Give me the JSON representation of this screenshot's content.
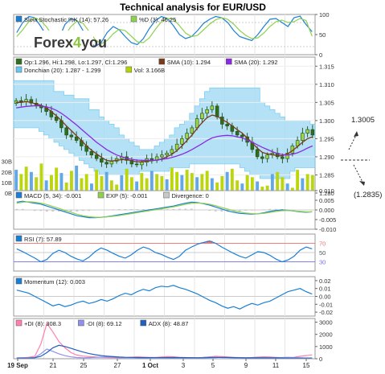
{
  "chart_data": {
    "type": "line",
    "title": "Technical analysis for EUR/USD",
    "brand": "Forex4you",
    "x_axis": {
      "ticks": [
        "19 Sep",
        "21",
        "25",
        "27",
        "1 Oct",
        "3",
        "5",
        "9",
        "11",
        "15"
      ]
    },
    "annotations": [
      {
        "text": "1.3005",
        "direction": "up"
      },
      {
        "text": "(1.2835)",
        "direction": "down"
      }
    ],
    "panels": [
      {
        "id": "stochastic",
        "legend": [
          {
            "label": "Slow Stochastic %K (14): 57.26",
            "color": "#1a7fd4"
          },
          {
            "label": "%D (3): 46.25",
            "color": "#8fd14f"
          }
        ],
        "y_ticks": [
          "100",
          "50",
          "0"
        ],
        "ylim": [
          0,
          100
        ],
        "series": [
          {
            "color": "#1a7fd4",
            "values": [
              55,
              80,
              95,
              92,
              70,
              45,
              25,
              40,
              75,
              90,
              85,
              60,
              35,
              20,
              30,
              55,
              70,
              62,
              45,
              30,
              25,
              40,
              65,
              85,
              95,
              90,
              72,
              50,
              40,
              45,
              60,
              78,
              88,
              95,
              92,
              80,
              60,
              45,
              40,
              35,
              50,
              70,
              88,
              90,
              80,
              70,
              92,
              96,
              75,
              57
            ]
          },
          {
            "color": "#8fd14f",
            "values": [
              45,
              62,
              82,
              92,
              85,
              68,
              45,
              35,
              48,
              70,
              84,
              78,
              58,
              38,
              27,
              35,
              52,
              63,
              60,
              46,
              32,
              30,
              42,
              63,
              82,
              90,
              88,
              72,
              54,
              45,
              48,
              62,
              76,
              87,
              92,
              88,
              76,
              60,
              48,
              40,
              42,
              54,
              70,
              82,
              86,
              80,
              82,
              90,
              85,
              46
            ]
          }
        ]
      },
      {
        "id": "price",
        "legend": [
          {
            "label": "Op:1.296, Hi:1.298, Lo:1.297, Cl:1.296",
            "color": "#2f6d1f"
          },
          {
            "label": "SMA (10): 1.294",
            "color": "#7a3b1a"
          },
          {
            "label": "SMA (20): 1.292",
            "color": "#8a2be2"
          },
          {
            "label": "Donchian (20): 1.287 - 1.299",
            "color": "#66c7f0"
          },
          {
            "label": "Vol: 3.166B",
            "color": "#b8d400"
          }
        ],
        "y_ticks": [
          "1.315",
          "1.310",
          "1.305",
          "1.300",
          "1.295",
          "1.290",
          "1.285",
          "1.280"
        ],
        "ylim": [
          1.28,
          1.3175
        ],
        "volume_ticks": [
          "30B",
          "20B",
          "10B",
          "0B"
        ],
        "volume_max": 32,
        "close": [
          1.3055,
          1.3052,
          1.3058,
          1.3048,
          1.304,
          1.3035,
          1.3025,
          1.301,
          1.3,
          1.298,
          1.296,
          1.2955,
          1.2945,
          1.293,
          1.2915,
          1.2905,
          1.2895,
          1.2885,
          1.288,
          1.2888,
          1.2895,
          1.29,
          1.289,
          1.288,
          1.2878,
          1.2885,
          1.2895,
          1.289,
          1.29,
          1.2905,
          1.291,
          1.292,
          1.2935,
          1.295,
          1.2965,
          1.298,
          1.3005,
          1.302,
          1.303,
          1.304,
          1.301,
          1.299,
          1.2985,
          1.297,
          1.296,
          1.2955,
          1.294,
          1.292,
          1.29,
          1.2895,
          1.2905,
          1.291,
          1.29,
          1.2895,
          1.291,
          1.293,
          1.2945,
          1.2965,
          1.2975,
          1.296
        ],
        "volume": [
          22,
          18,
          25,
          20,
          15,
          28,
          12,
          17,
          24,
          19,
          10,
          21,
          26,
          14,
          18,
          9,
          22,
          16,
          20,
          12,
          8,
          17,
          23,
          15,
          11,
          19,
          14,
          21,
          18,
          16,
          13,
          24,
          20,
          17,
          22,
          19,
          15,
          18,
          21,
          14,
          10,
          16,
          20,
          23,
          12,
          9,
          17,
          15,
          11,
          6,
          7,
          18,
          20,
          15,
          9,
          5,
          22,
          14,
          18,
          17
        ],
        "sma10": [
          1.305,
          1.305,
          1.3052,
          1.305,
          1.3045,
          1.3042,
          1.3035,
          1.3025,
          1.3013,
          1.3,
          1.2985,
          1.2972,
          1.2958,
          1.2945,
          1.293,
          1.2918,
          1.2908,
          1.2898,
          1.289,
          1.2888,
          1.289,
          1.2892,
          1.2892,
          1.2889,
          1.2886,
          1.2886,
          1.2888,
          1.2889,
          1.2891,
          1.2894,
          1.29,
          1.2907,
          1.2917,
          1.293,
          1.2945,
          1.296,
          1.2978,
          1.2994,
          1.3008,
          1.3015,
          1.3012,
          1.3003,
          1.2995,
          1.2985,
          1.2975,
          1.2965,
          1.2952,
          1.2938,
          1.2924,
          1.2912,
          1.2908,
          1.2906,
          1.2903,
          1.2903,
          1.2908,
          1.2917,
          1.2928,
          1.294,
          1.295,
          1.2955
        ],
        "sma20": [
          1.3035,
          1.3037,
          1.3039,
          1.304,
          1.3041,
          1.304,
          1.3038,
          1.3034,
          1.3028,
          1.302,
          1.301,
          1.2999,
          1.2988,
          1.2976,
          1.2964,
          1.2952,
          1.294,
          1.293,
          1.292,
          1.2912,
          1.2905,
          1.29,
          1.2896,
          1.2893,
          1.2891,
          1.289,
          1.289,
          1.289,
          1.2891,
          1.2893,
          1.2895,
          1.2898,
          1.2902,
          1.2907,
          1.2913,
          1.292,
          1.2928,
          1.2936,
          1.2945,
          1.2952,
          1.2956,
          1.2958,
          1.2959,
          1.2958,
          1.2955,
          1.2952,
          1.2946,
          1.294,
          1.2933,
          1.2926,
          1.292,
          1.2914,
          1.2909,
          1.2906,
          1.2905,
          1.2907,
          1.2911,
          1.2917,
          1.2924,
          1.293
        ],
        "donchian_upper": [
          1.311,
          1.311,
          1.311,
          1.311,
          1.311,
          1.311,
          1.311,
          1.311,
          1.308,
          1.308,
          1.307,
          1.307,
          1.306,
          1.306,
          1.306,
          1.303,
          1.303,
          1.301,
          1.3,
          1.299,
          1.298,
          1.296,
          1.295,
          1.294,
          1.293,
          1.292,
          1.292,
          1.292,
          1.293,
          1.294,
          1.295,
          1.296,
          1.298,
          1.299,
          1.3,
          1.302,
          1.304,
          1.306,
          1.308,
          1.309,
          1.309,
          1.309,
          1.309,
          1.309,
          1.309,
          1.309,
          1.309,
          1.309,
          1.309,
          1.305,
          1.304,
          1.303,
          1.302,
          1.301,
          1.3,
          1.3,
          1.3,
          1.3,
          1.3,
          1.299
        ],
        "donchian_lower": [
          1.298,
          1.298,
          1.298,
          1.298,
          1.298,
          1.297,
          1.296,
          1.295,
          1.294,
          1.293,
          1.292,
          1.291,
          1.29,
          1.289,
          1.288,
          1.287,
          1.286,
          1.285,
          1.285,
          1.285,
          1.285,
          1.285,
          1.285,
          1.285,
          1.285,
          1.286,
          1.286,
          1.286,
          1.286,
          1.286,
          1.286,
          1.287,
          1.287,
          1.287,
          1.287,
          1.288,
          1.288,
          1.288,
          1.288,
          1.288,
          1.288,
          1.288,
          1.288,
          1.288,
          1.288,
          1.287,
          1.286,
          1.285,
          1.285,
          1.284,
          1.284,
          1.284,
          1.284,
          1.284,
          1.284,
          1.286,
          1.287,
          1.287,
          1.287,
          1.287
        ]
      },
      {
        "id": "macd",
        "legend": [
          {
            "label": "MACD (5, 34): -0.001",
            "color": "#1a7fd4"
          },
          {
            "label": "EXP (5): -0.001",
            "color": "#8fd14f"
          },
          {
            "label": "Divergence: 0",
            "color": "#c8c8c8"
          }
        ],
        "y_ticks": [
          "0.010",
          "0.005",
          "0.000",
          "-0.005",
          "-0.010"
        ],
        "ylim": [
          -0.01,
          0.01
        ],
        "series": [
          {
            "color": "#1a7fd4",
            "values": [
              0.004,
              0.0045,
              0.004,
              0.0035,
              0.003,
              0.002,
              0.001,
              0,
              -0.001,
              -0.002,
              -0.003,
              -0.0035,
              -0.004,
              -0.004,
              -0.0038,
              -0.0035,
              -0.003,
              -0.0025,
              -0.002,
              -0.0015,
              -0.001,
              -0.0005,
              0,
              0.0005,
              0.001,
              0.0015,
              0.002,
              0.0028,
              0.0035,
              0.004,
              0.0038,
              0.0032,
              0.0025,
              0.0015,
              0.0005,
              -0.0005,
              -0.0012,
              -0.0018,
              -0.002,
              -0.0022,
              -0.002,
              -0.0015,
              -0.0008,
              -0.0003,
              0,
              -0.0002,
              -0.0006,
              -0.001,
              -0.0012,
              -0.001
            ]
          },
          {
            "color": "#8fd14f",
            "values": [
              0.0035,
              0.004,
              0.0042,
              0.004,
              0.0035,
              0.0028,
              0.0018,
              0.0008,
              -0.0002,
              -0.0012,
              -0.0022,
              -0.003,
              -0.0035,
              -0.0038,
              -0.0038,
              -0.0036,
              -0.0033,
              -0.0029,
              -0.0024,
              -0.0019,
              -0.0014,
              -0.0009,
              -0.0004,
              0.0001,
              0.0006,
              0.0011,
              0.0016,
              0.0022,
              0.0029,
              0.0034,
              0.0036,
              0.0034,
              0.0029,
              0.0022,
              0.0013,
              0.0004,
              -0.0004,
              -0.0011,
              -0.0016,
              -0.0019,
              -0.002,
              -0.0018,
              -0.0013,
              -0.0008,
              -0.0004,
              -0.0003,
              -0.0005,
              -0.0008,
              -0.001,
              -0.001
            ]
          }
        ]
      },
      {
        "id": "rsi",
        "legend": [
          {
            "label": "RSI (7): 57.89",
            "color": "#1a7fd4"
          }
        ],
        "y_ticks": [
          "70",
          "50",
          "30"
        ],
        "ylim": [
          10,
          90
        ],
        "levels": [
          70,
          50,
          30
        ],
        "series": [
          {
            "color": "#1a7fd4",
            "values": [
              58,
              52,
              45,
              38,
              30,
              35,
              48,
              55,
              50,
              42,
              36,
              32,
              40,
              52,
              60,
              55,
              48,
              42,
              38,
              45,
              55,
              62,
              58,
              50,
              46,
              40,
              35,
              42,
              55,
              62,
              68,
              72,
              75,
              70,
              62,
              55,
              48,
              42,
              38,
              45,
              52,
              50,
              44,
              36,
              30,
              34,
              42,
              55,
              62,
              58
            ]
          }
        ]
      },
      {
        "id": "momentum",
        "legend": [
          {
            "label": "Momentum (12): 0.003",
            "color": "#1a7fd4"
          }
        ],
        "y_ticks": [
          "0.02",
          "0.01",
          "0.00",
          "-0.01",
          "-0.02"
        ],
        "ylim": [
          -0.025,
          0.025
        ],
        "series": [
          {
            "color": "#1a7fd4",
            "values": [
              0.008,
              0.006,
              0.004,
              0,
              -0.004,
              -0.008,
              -0.012,
              -0.01,
              -0.013,
              -0.011,
              -0.008,
              -0.006,
              -0.009,
              -0.007,
              -0.004,
              -0.006,
              -0.003,
              0.001,
              0.004,
              0.002,
              0.006,
              0.009,
              0.007,
              0.011,
              0.013,
              0.012,
              0.014,
              0.011,
              0.009,
              0.006,
              0.003,
              -0.001,
              -0.005,
              -0.008,
              -0.012,
              -0.015,
              -0.013,
              -0.016,
              -0.012,
              -0.009,
              -0.011,
              -0.008,
              -0.006,
              -0.002,
              0.002,
              0.006,
              0.008,
              0.01,
              0.006,
              0.003
            ]
          }
        ]
      },
      {
        "id": "dmi",
        "legend": [
          {
            "label": "+DI (8): 308.3",
            "color": "#ff80b0"
          },
          {
            "label": "-DI (8): 69.12",
            "color": "#9090f0"
          },
          {
            "label": "ADX (8): 48.87",
            "color": "#2060c0"
          }
        ],
        "y_ticks": [
          "3000",
          "2000",
          "1000",
          "0"
        ],
        "ylim": [
          0,
          3300
        ],
        "series": [
          {
            "color": "#ff80b0",
            "values": [
              50,
              80,
              120,
              200,
              1200,
              2900,
              2200,
              1400,
              900,
              500,
              300,
              220,
              180,
              150,
              120,
              100,
              90,
              80,
              90,
              120,
              150,
              130,
              110,
              100,
              140,
              180,
              160,
              120,
              100,
              90,
              80,
              100,
              150,
              200,
              180,
              140,
              110,
              90,
              80,
              100,
              130,
              160,
              140,
              110,
              90,
              80,
              120,
              200,
              260,
              308
            ]
          },
          {
            "color": "#9090f0",
            "values": [
              80,
              70,
              60,
              100,
              400,
              800,
              600,
              400,
              250,
              150,
              100,
              80,
              90,
              110,
              130,
              150,
              120,
              100,
              90,
              80,
              70,
              60,
              80,
              100,
              90,
              80,
              70,
              60,
              50,
              60,
              80,
              110,
              140,
              120,
              100,
              90,
              80,
              70,
              60,
              80,
              90,
              70,
              60,
              80,
              100,
              120,
              90,
              70,
              60,
              69
            ]
          },
          {
            "color": "#2060c0",
            "values": [
              40,
              50,
              60,
              80,
              200,
              500,
              900,
              1100,
              1000,
              850,
              700,
              550,
              420,
              330,
              260,
              210,
              170,
              140,
              120,
              110,
              100,
              95,
              90,
              85,
              90,
              95,
              100,
              95,
              90,
              85,
              80,
              82,
              90,
              100,
              110,
              105,
              95,
              85,
              75,
              70,
              72,
              75,
              78,
              70,
              60,
              52,
              50,
              55,
              52,
              49
            ]
          }
        ]
      }
    ]
  }
}
